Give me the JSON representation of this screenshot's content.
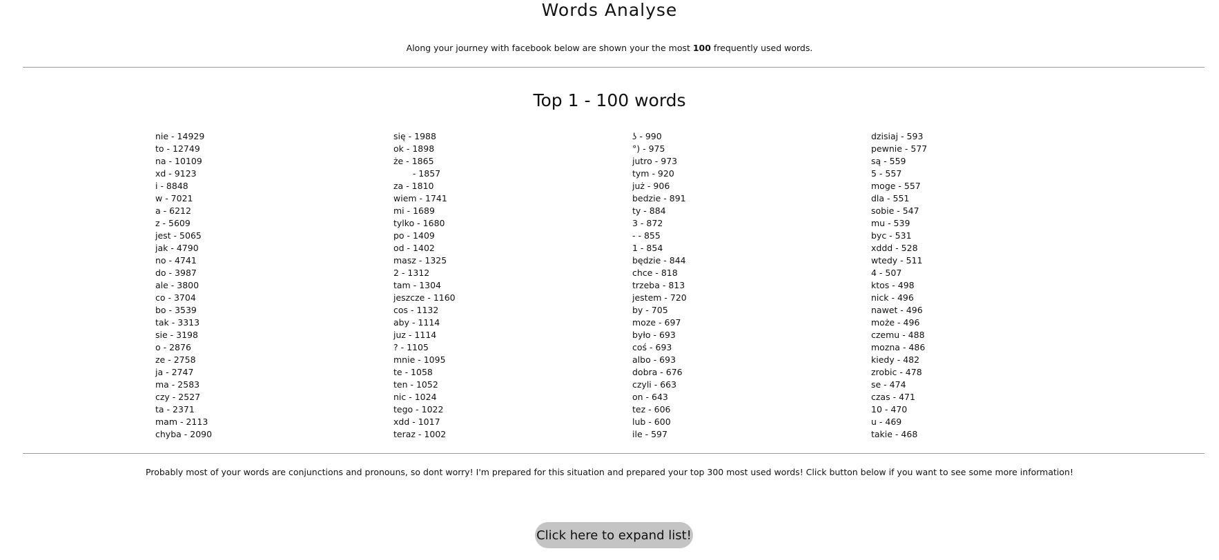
{
  "header": {
    "title": "Words Analyse",
    "intro_prefix": "Along your journey with facebook below are shown your the most ",
    "intro_highlight": "100",
    "intro_suffix": " frequently used words."
  },
  "section": {
    "title": "Top 1 - 100 words"
  },
  "columns": [
    [
      "nie - 14929",
      "to - 12749",
      "na - 10109",
      "xd - 9123",
      "i - 8848",
      "w - 7021",
      "a - 6212",
      "z - 5609",
      "jest - 5065",
      "jak - 4790",
      "no - 4741",
      "do - 3987",
      "ale - 3800",
      "co - 3704",
      "bo - 3539",
      "tak - 3313",
      "sie - 3198",
      "o - 2876",
      "ze - 2758",
      "ja - 2747",
      "ma - 2583",
      "czy - 2527",
      "ta - 2371",
      "mam - 2113",
      "chyba - 2090"
    ],
    [
      "się - 1988",
      "ok - 1898",
      "że - 1865",
      "       - 1857",
      "za - 1810",
      "wiem - 1741",
      "mi - 1689",
      "tylko - 1680",
      "po - 1409",
      "od - 1402",
      "masz - 1325",
      "2 - 1312",
      "tam - 1304",
      "jeszcze - 1160",
      "cos - 1132",
      "aby - 1114",
      "juz - 1114",
      "? - 1105",
      "mnie - 1095",
      "te - 1058",
      "ten - 1052",
      "nic - 1024",
      "tego - 1022",
      "xdd - 1017",
      "teraz - 1002"
    ],
    [
      "ʖ - 990",
      "°) - 975",
      "jutro - 973",
      "tym - 920",
      "już - 906",
      "bedzie - 891",
      "ty - 884",
      "3 - 872",
      "- - 855",
      "1 - 854",
      "będzie - 844",
      "chce - 818",
      "trzeba - 813",
      "jestem - 720",
      "by - 705",
      "moze - 697",
      "było - 693",
      "coś - 693",
      "albo - 693",
      "dobra - 676",
      "czyli - 663",
      "on - 643",
      "tez - 606",
      "lub - 600",
      "ile - 597"
    ],
    [
      "dzisiaj - 593",
      "pewnie - 577",
      "są - 559",
      "5 - 557",
      "moge - 557",
      "dla - 551",
      "sobie - 547",
      "mu - 539",
      "byc - 531",
      "xddd - 528",
      "wtedy - 511",
      "4 - 507",
      "ktos - 498",
      "nick - 496",
      "nawet - 496",
      "może - 496",
      "czemu - 488",
      "mozna - 486",
      "kiedy - 482",
      "zrobic - 478",
      "se - 474",
      "czas - 471",
      "10 - 470",
      "u - 469",
      "takie - 468"
    ]
  ],
  "footer": {
    "note": "Probably most of your words are conjunctions and pronouns, so dont worry! I'm prepared for this situation and prepared your top 300 most used words! Click button below if you want to see some more information!",
    "button_label": "Click here to expand list!"
  }
}
